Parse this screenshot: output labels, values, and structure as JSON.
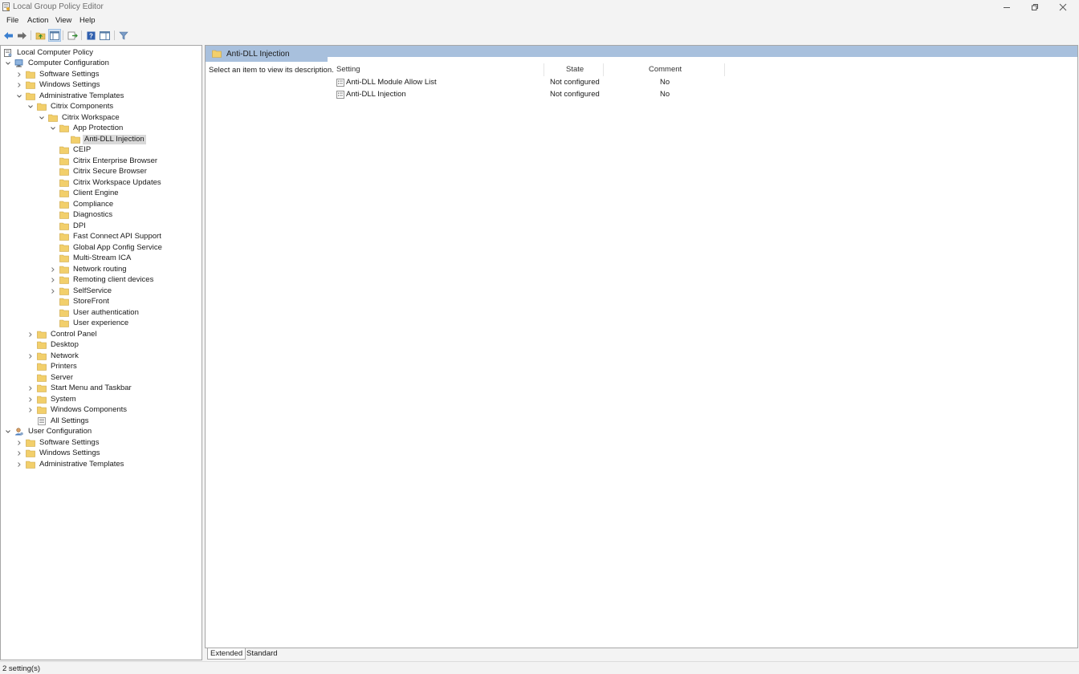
{
  "window": {
    "title": "Local Group Policy Editor"
  },
  "menu": [
    "File",
    "Action",
    "View",
    "Help"
  ],
  "toolbar": {
    "icons": [
      "back-arrow-icon",
      "forward-arrow-icon",
      "up-folder-icon",
      "show-hide-tree-icon",
      "export-list-icon",
      "help-icon",
      "show-hide-action-pane-icon",
      "filter-icon"
    ]
  },
  "tree": {
    "root": "Local Computer Policy",
    "computer_configuration": "Computer Configuration",
    "cc_software_settings": "Software Settings",
    "cc_windows_settings": "Windows Settings",
    "cc_administrative_templates": "Administrative Templates",
    "citrix_components": "Citrix Components",
    "citrix_workspace": "Citrix Workspace",
    "app_protection": "App Protection",
    "anti_dll_injection": "Anti-DLL Injection",
    "workspace_children": [
      "CEIP",
      "Citrix Enterprise Browser",
      "Citrix Secure Browser",
      "Citrix Workspace Updates",
      "Client Engine",
      "Compliance",
      "Diagnostics",
      "DPI",
      "Fast Connect API Support",
      "Global App Config Service",
      "Multi-Stream ICA",
      "Network routing",
      "Remoting client devices",
      "SelfService",
      "StoreFront",
      "User authentication",
      "User experience"
    ],
    "admin_children": [
      "Control Panel",
      "Desktop",
      "Network",
      "Printers",
      "Server",
      "Start Menu and Taskbar",
      "System",
      "Windows Components",
      "All Settings"
    ],
    "user_configuration": "User Configuration",
    "uc_software_settings": "Software Settings",
    "uc_windows_settings": "Windows Settings",
    "uc_administrative_templates": "Administrative Templates"
  },
  "details": {
    "header_title": "Anti-DLL Injection",
    "description_prompt": "Select an item to view its description.",
    "columns": {
      "setting": "Setting",
      "state": "State",
      "comment": "Comment"
    },
    "rows": [
      {
        "setting": "Anti-DLL Module Allow List",
        "state": "Not configured",
        "comment": "No"
      },
      {
        "setting": "Anti-DLL Injection",
        "state": "Not configured",
        "comment": "No"
      }
    ]
  },
  "bottom_tabs": {
    "extended": "Extended",
    "standard": "Standard"
  },
  "status": {
    "text": "2 setting(s)"
  }
}
